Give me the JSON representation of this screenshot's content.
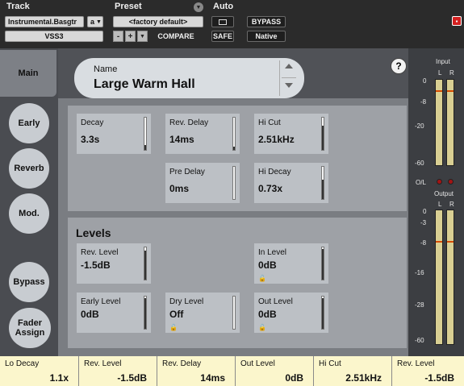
{
  "header": {
    "track_label": "Track",
    "track_name": "Instrumental.Basgtr",
    "track_variant": "a",
    "insert": "VSS3",
    "preset_label": "Preset",
    "preset_name": "<factory default>",
    "minus": "-",
    "plus": "+",
    "compare": "COMPARE",
    "auto_label": "Auto",
    "safe": "SAFE",
    "bypass": "BYPASS",
    "native": "Native"
  },
  "tabs": {
    "main": "Main",
    "early": "Early",
    "reverb": "Reverb",
    "mod": "Mod.",
    "bypass": "Bypass",
    "fader_assign": "Fader Assign"
  },
  "name": {
    "label": "Name",
    "value": "Large Warm Hall"
  },
  "help": "?",
  "params": {
    "decay": {
      "label": "Decay",
      "value": "3.3s",
      "level": 0.15
    },
    "rev_delay": {
      "label": "Rev. Delay",
      "value": "14ms",
      "level": 0.1
    },
    "hi_cut": {
      "label": "Hi Cut",
      "value": "2.51kHz",
      "level": 0.75
    },
    "pre_delay": {
      "label": "Pre Delay",
      "value": "0ms",
      "level": 0.0
    },
    "hi_decay": {
      "label": "Hi Decay",
      "value": "0.73x",
      "level": 0.6
    }
  },
  "levels": {
    "title": "Levels",
    "rev_level": {
      "label": "Rev. Level",
      "value": "-1.5dB",
      "level": 0.9
    },
    "in_level": {
      "label": "In Level",
      "value": "0dB",
      "level": 0.95
    },
    "early_level": {
      "label": "Early Level",
      "value": "0dB",
      "level": 0.95
    },
    "dry_level": {
      "label": "Dry Level",
      "value": "Off",
      "level": 0.0
    },
    "out_level": {
      "label": "Out Level",
      "value": "0dB",
      "level": 0.95
    }
  },
  "meters": {
    "input_label": "Input",
    "output_label": "Output",
    "ol_label": "O/L",
    "L": "L",
    "R": "R",
    "scale": [
      "0",
      "-8",
      "-20",
      "-60"
    ],
    "scale_out": [
      "0",
      "-3",
      "-8",
      "-16",
      "-28",
      "-60"
    ],
    "input_level": 0.88,
    "output_level": 0.82
  },
  "footer": [
    {
      "label": "Lo Decay",
      "value": "1.1x"
    },
    {
      "label": "Rev. Level",
      "value": "-1.5dB"
    },
    {
      "label": "Rev. Delay",
      "value": "14ms"
    },
    {
      "label": "Out Level",
      "value": "0dB"
    },
    {
      "label": "Hi Cut",
      "value": "2.51kHz"
    },
    {
      "label": "Rev. Level",
      "value": "-1.5dB"
    }
  ],
  "colors": {
    "footer_bg": "#fbf6cc",
    "meter_fill": "#d9cf93",
    "meter_peak": "#d84b00",
    "close_red": "#d42020"
  }
}
